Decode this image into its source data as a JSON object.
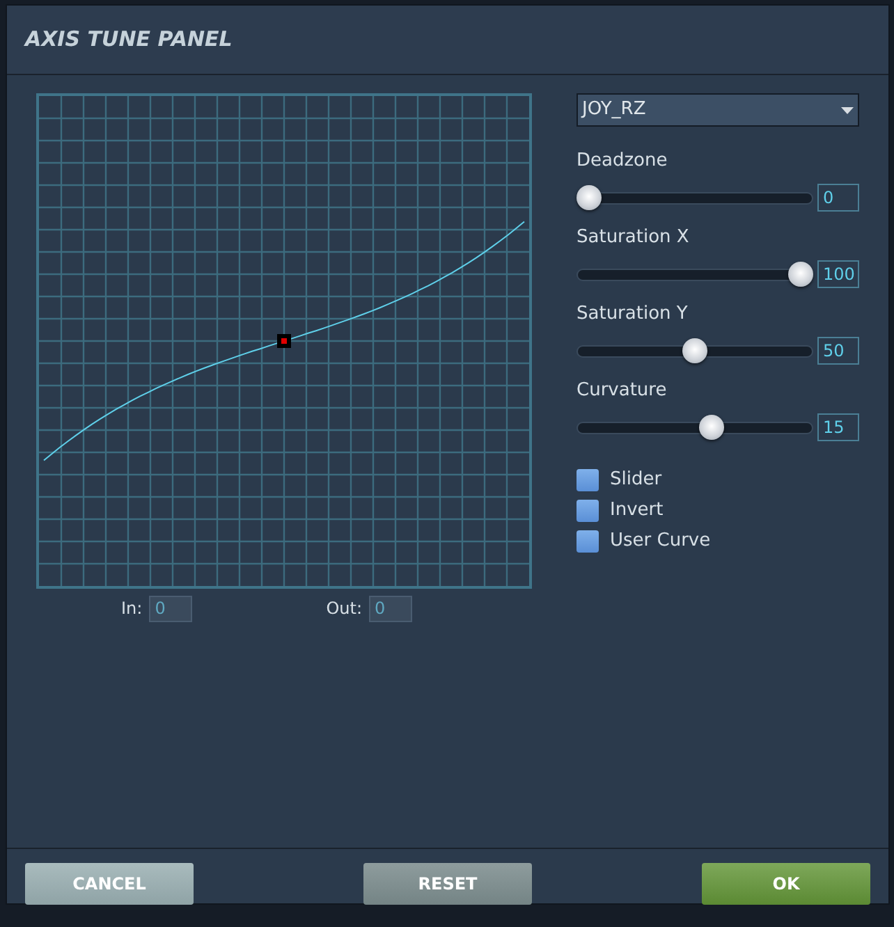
{
  "window": {
    "title": "AXIS TUNE PANEL"
  },
  "axis_select": {
    "value": "JOY_RZ"
  },
  "sliders": [
    {
      "label": "Deadzone",
      "level": 0,
      "value": "0"
    },
    {
      "label": "Saturation X",
      "level": 1,
      "value": "100"
    },
    {
      "label": "Saturation Y",
      "level": 0.5,
      "value": "50"
    },
    {
      "label": "Curvature",
      "level": 0.58,
      "value": "15"
    }
  ],
  "options": [
    {
      "label": "Slider",
      "checked": false
    },
    {
      "label": "Invert",
      "checked": false
    },
    {
      "label": "User Curve",
      "checked": false
    }
  ],
  "readouts": [
    {
      "label": "In:",
      "value": "0"
    },
    {
      "label": "Out:",
      "value": "0"
    }
  ],
  "buttons": [
    {
      "label": "CANCEL",
      "kind": "cancel"
    },
    {
      "label": "RESET",
      "kind": "reset"
    },
    {
      "label": "OK",
      "kind": "ok"
    }
  ]
}
